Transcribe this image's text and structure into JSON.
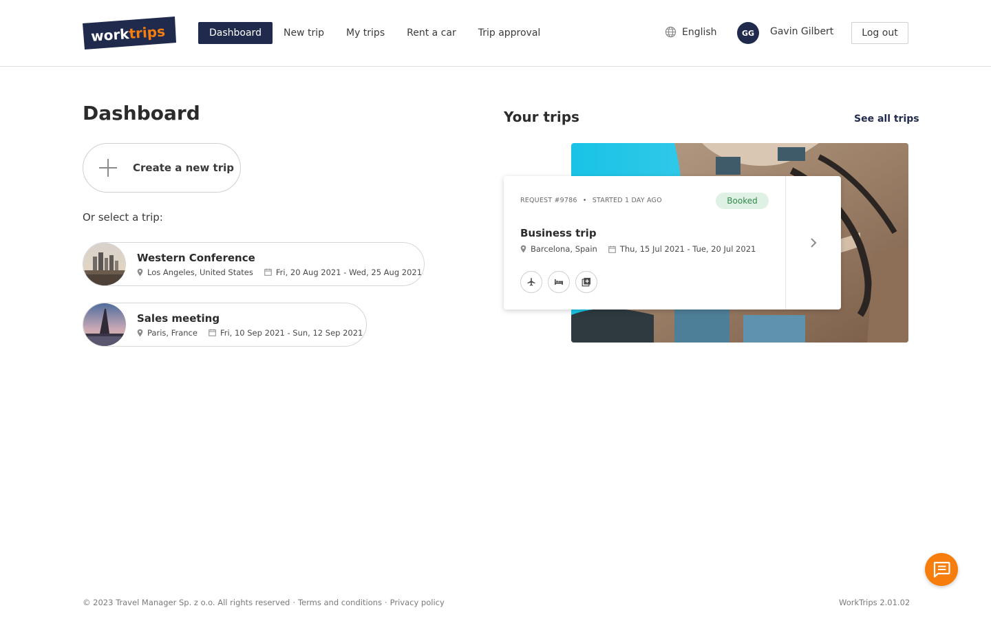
{
  "brand": {
    "logo_text_1": "work",
    "logo_text_2": "trips"
  },
  "nav": {
    "items": [
      {
        "label": "Dashboard",
        "active": true
      },
      {
        "label": "New trip"
      },
      {
        "label": "My trips"
      },
      {
        "label": "Rent a car"
      },
      {
        "label": "Trip approval"
      }
    ]
  },
  "header": {
    "language": "English",
    "user_initials": "GG",
    "user_name": "Gavin Gilbert",
    "logout_label": "Log out"
  },
  "main": {
    "title": "Dashboard",
    "create_label": "Create a new trip",
    "or_select": "Or select a trip:",
    "trips": [
      {
        "name": "Western Conference",
        "location": "Los Angeles, United States",
        "dates": "Fri, 20 Aug 2021 - Wed, 25 Aug 2021"
      },
      {
        "name": "Sales meeting",
        "location": "Paris, France",
        "dates": "Fri, 10 Sep 2021 - Sun, 12 Sep 2021"
      }
    ]
  },
  "your_trips": {
    "title": "Your trips",
    "see_all": "See all trips",
    "card": {
      "request": "REQUEST #9786",
      "started": "STARTED 1 DAY AGO",
      "status": "Booked",
      "title": "Business trip",
      "location": "Barcelona, Spain",
      "dates": "Thu, 15 Jul 2021 - Tue, 20 Jul 2021",
      "services": [
        "airplane-icon",
        "bed-icon",
        "add-service-icon"
      ]
    }
  },
  "footer": {
    "copyright": "© 2023 Travel Manager Sp. z o.o. All rights reserved",
    "sep": "·",
    "terms": "Terms and conditions",
    "privacy": "Privacy policy",
    "version": "WorkTrips 2.01.02"
  },
  "colors": {
    "primary": "#1f2a4d",
    "accent": "#f77d0d",
    "success_bg": "#dff1e4",
    "success_text": "#2f8a4a"
  }
}
